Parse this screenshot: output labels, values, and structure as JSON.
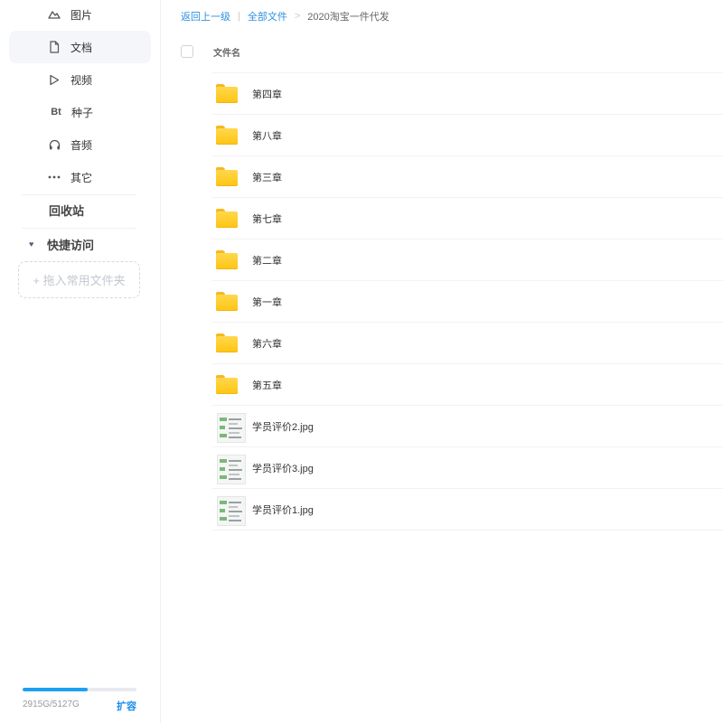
{
  "sidebar": {
    "items": [
      {
        "label": "图片",
        "icon": "image-icon"
      },
      {
        "label": "文档",
        "icon": "document-icon",
        "active": true
      },
      {
        "label": "视频",
        "icon": "play-icon"
      },
      {
        "label": "种子",
        "icon": "bt-icon",
        "icon_text": "Bt"
      },
      {
        "label": "音频",
        "icon": "headphones-icon"
      },
      {
        "label": "其它",
        "icon": "more-icon"
      }
    ],
    "recycle_bin": "回收站",
    "quick_access": "快捷访问",
    "drop_hint": "+ 拖入常用文件夹",
    "storage": {
      "text": "2915G/5127G",
      "used_fraction": 0.569,
      "expand_label": "扩容"
    }
  },
  "breadcrumb": {
    "back": "返回上一级",
    "separator": "|",
    "root": "全部文件",
    "arrow": ">",
    "current": "2020淘宝一件代发"
  },
  "list": {
    "column_header": "文件名",
    "rows": [
      {
        "name": "第四章",
        "type": "folder"
      },
      {
        "name": "第八章",
        "type": "folder"
      },
      {
        "name": "第三章",
        "type": "folder"
      },
      {
        "name": "第七章",
        "type": "folder"
      },
      {
        "name": "第二章",
        "type": "folder"
      },
      {
        "name": "第一章",
        "type": "folder"
      },
      {
        "name": "第六章",
        "type": "folder"
      },
      {
        "name": "第五章",
        "type": "folder"
      },
      {
        "name": "学员评价2.jpg",
        "type": "image"
      },
      {
        "name": "学员评价3.jpg",
        "type": "image"
      },
      {
        "name": "学员评价1.jpg",
        "type": "image"
      }
    ]
  },
  "colors": {
    "accent": "#1ba0f2",
    "folder": "#ffc412"
  }
}
